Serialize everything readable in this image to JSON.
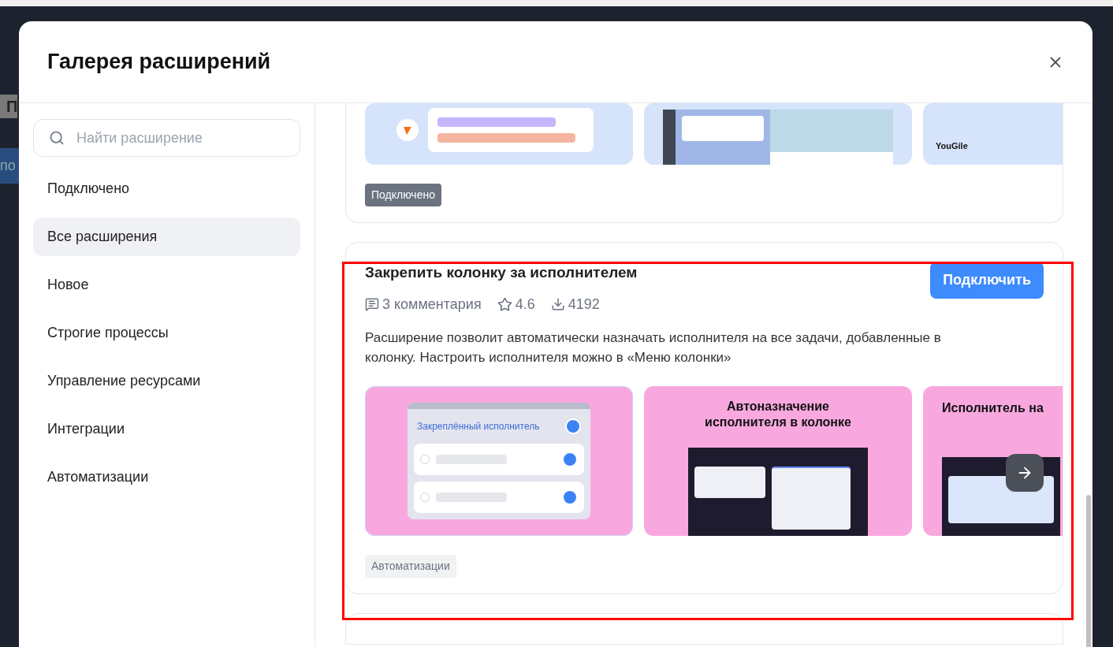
{
  "backdrop": {
    "fragments": [
      "П",
      "по"
    ]
  },
  "dialog": {
    "title": "Галерея расширений"
  },
  "search": {
    "placeholder": "Найти расширение"
  },
  "sidebar": {
    "items": [
      {
        "label": "Подключено",
        "selected": false
      },
      {
        "label": "Все расширения",
        "selected": true
      },
      {
        "label": "Новое",
        "selected": false
      },
      {
        "label": "Строгие процессы",
        "selected": false
      },
      {
        "label": "Управление ресурсами",
        "selected": false
      },
      {
        "label": "Интеграции",
        "selected": false
      },
      {
        "label": "Автоматизации",
        "selected": false
      }
    ]
  },
  "extensions": [
    {
      "images": [
        {
          "kind": "chat"
        },
        {
          "kind": "board"
        },
        {
          "kind": "logo",
          "caption": "YouGile"
        }
      ],
      "tag": {
        "kind": "status",
        "label": "Подключено"
      }
    },
    {
      "title": "Закрепить колонку за исполнителем",
      "button": "Подключить",
      "comments": "3 комментария",
      "rating": "4.6",
      "downloads": "4192",
      "description": "Расширение позволит автоматически назначать исполнителя на все задачи, добавленные в колонку. Настроить исполнителя можно в «Меню колонки»",
      "images": [
        {
          "kind": "pinned",
          "caption": "Закреплённый исполнитель"
        },
        {
          "kind": "auto",
          "caption": "Автоназначение исполнителя в колонке"
        },
        {
          "kind": "partial",
          "caption": "Исполнитель на"
        }
      ],
      "tag": {
        "kind": "category",
        "label": "Автоматизации"
      }
    }
  ]
}
